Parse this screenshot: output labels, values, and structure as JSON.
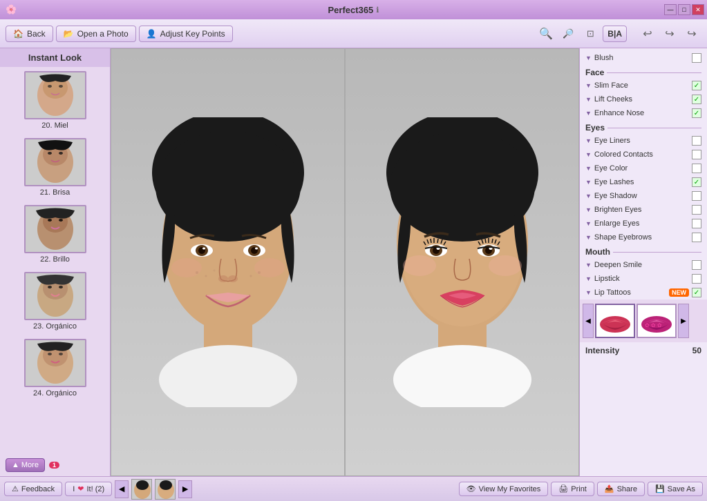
{
  "app": {
    "title": "Perfect365",
    "info_icon": "ℹ"
  },
  "win_controls": {
    "minimize": "—",
    "maximize": "□",
    "close": "✕"
  },
  "toolbar": {
    "back_label": "Back",
    "open_label": "Open a Photo",
    "adjust_label": "Adjust Key Points",
    "zoom_in": "🔍",
    "zoom_out": "🔍",
    "fit": "⊡",
    "bia": "B|A",
    "undo": "↩",
    "redo_left": "↪",
    "redo_right": "↪"
  },
  "sidebar": {
    "title": "Instant Look",
    "items": [
      {
        "id": 20,
        "label": "20. Miel"
      },
      {
        "id": 21,
        "label": "21. Brisa"
      },
      {
        "id": 22,
        "label": "22. Brillo"
      },
      {
        "id": 23,
        "label": "23. Orgánico"
      },
      {
        "id": 24,
        "label": "24. Orgánico"
      }
    ],
    "more_label": "More",
    "more_badge": "1"
  },
  "right_panel": {
    "blush_label": "Blush",
    "blush_checked": false,
    "face_section": "Face",
    "face_items": [
      {
        "label": "Slim Face",
        "checked": true
      },
      {
        "label": "Lift Cheeks",
        "checked": true
      },
      {
        "label": "Enhance Nose",
        "checked": true
      }
    ],
    "eyes_section": "Eyes",
    "eyes_items": [
      {
        "label": "Eye Liners",
        "checked": false
      },
      {
        "label": "Colored Contacts",
        "checked": false
      },
      {
        "label": "Eye Color",
        "checked": false
      },
      {
        "label": "Eye Lashes",
        "checked": true
      },
      {
        "label": "Eye Shadow",
        "checked": false
      },
      {
        "label": "Brighten Eyes",
        "checked": false
      },
      {
        "label": "Enlarge Eyes",
        "checked": false
      },
      {
        "label": "Shape Eyebrows",
        "checked": false
      }
    ],
    "mouth_section": "Mouth",
    "mouth_items": [
      {
        "label": "Deepen Smile",
        "checked": false
      },
      {
        "label": "Lipstick",
        "checked": false
      },
      {
        "label": "Lip Tattoos",
        "checked": true,
        "new": true
      }
    ],
    "intensity_label": "Intensity",
    "intensity_value": "50"
  },
  "bottombar": {
    "feedback_label": "Feedback",
    "heart_label": "I",
    "heart_it": "It! (2)",
    "view_fav_label": "View My Favorites",
    "print_label": "Print",
    "share_label": "Share",
    "save_label": "Save As"
  }
}
